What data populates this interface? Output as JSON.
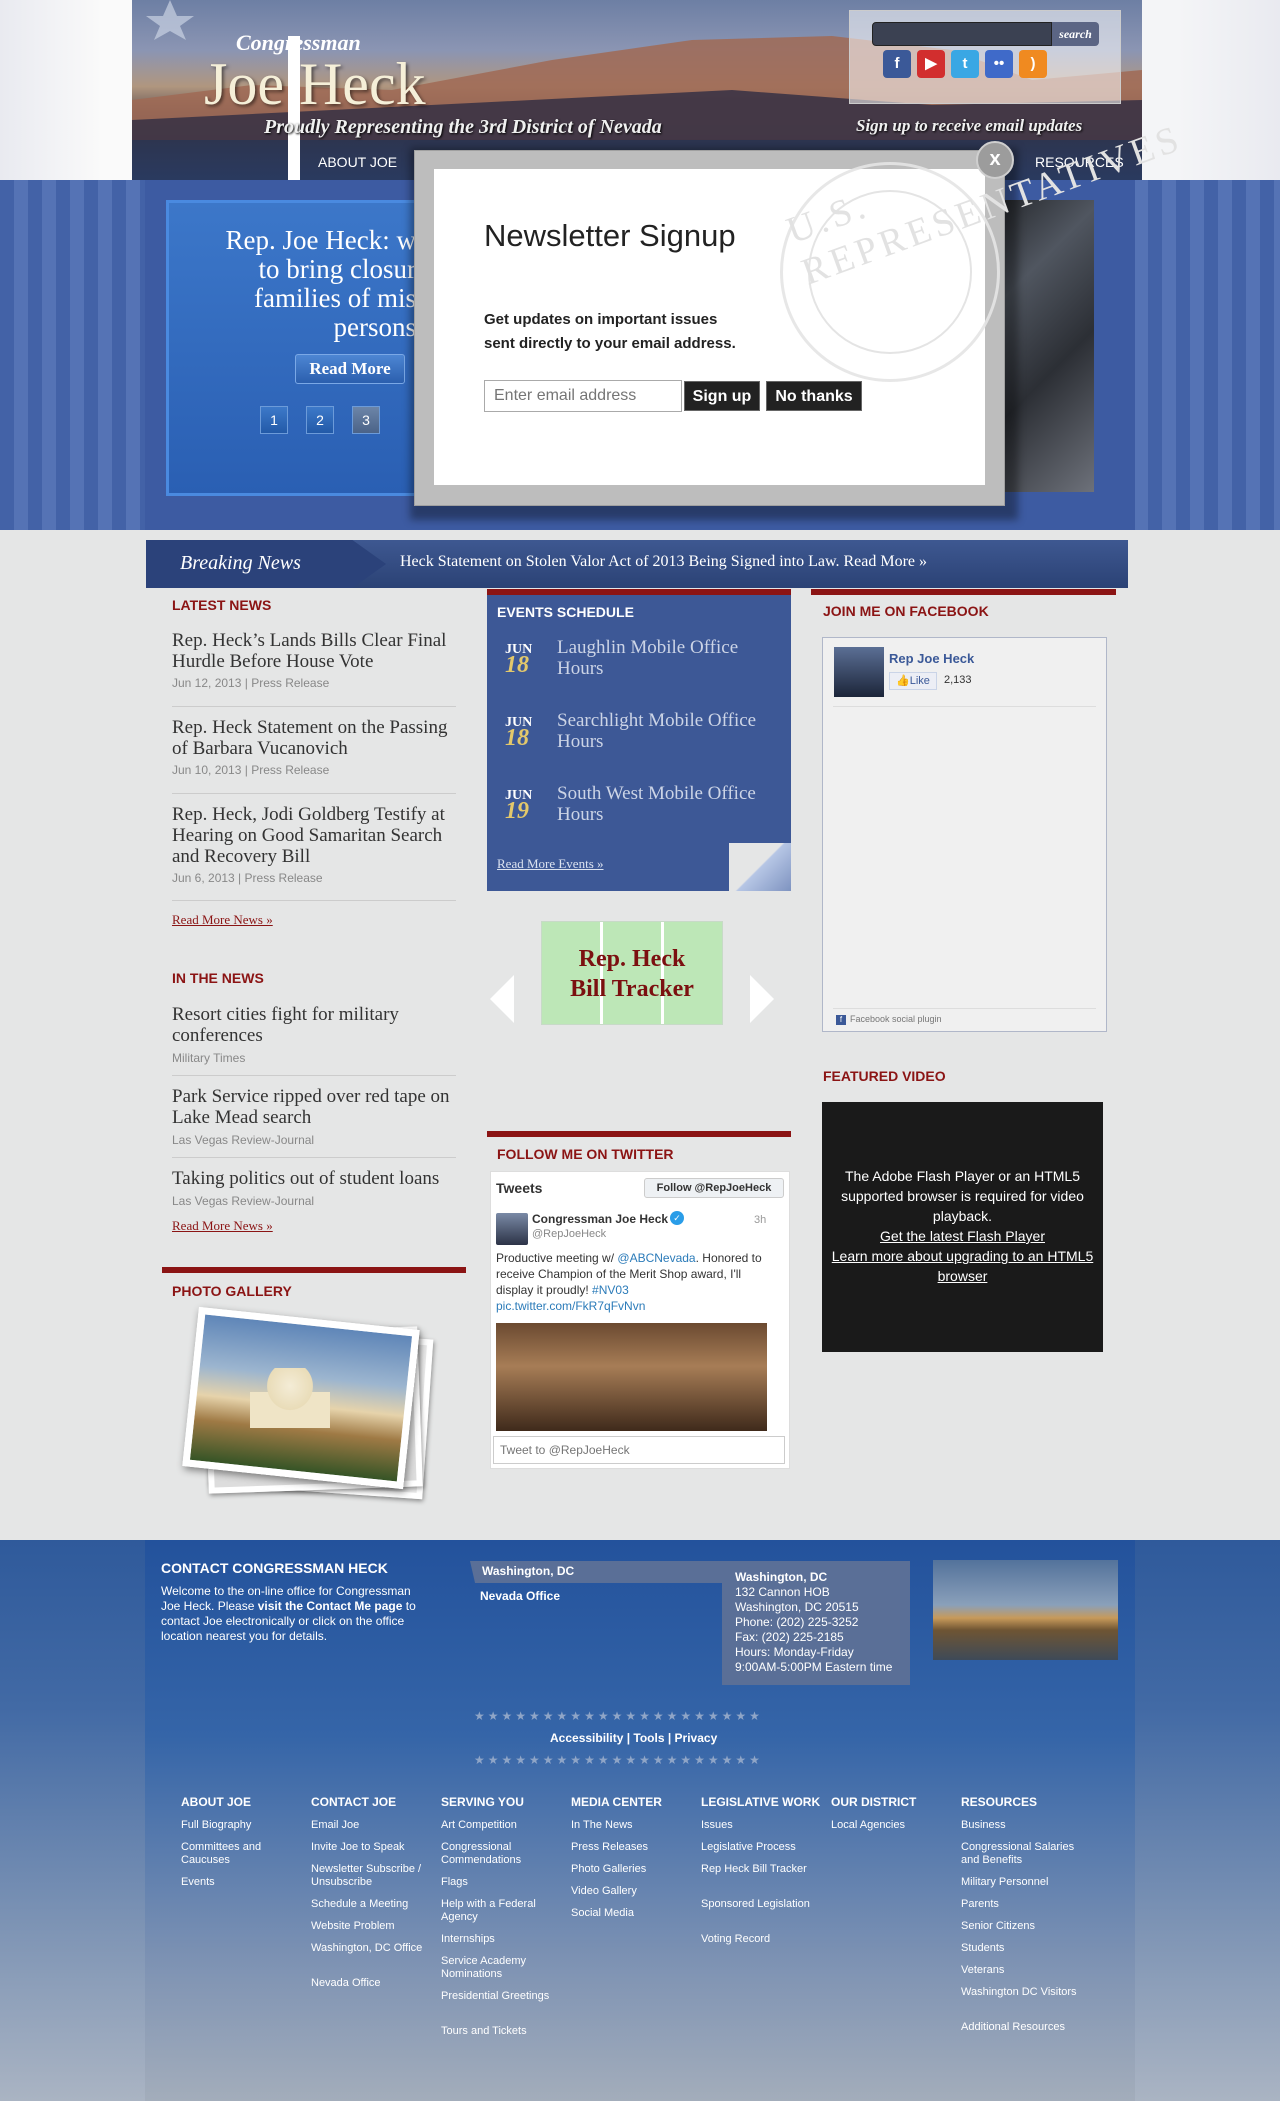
{
  "header": {
    "title_small": "Congressman",
    "title_big": "Joe Heck",
    "tagline": "Proudly Representing the 3rd District of Nevada",
    "signup_line": "Sign up to receive email updates",
    "search": {
      "placeholder": "",
      "button": "search"
    },
    "social": [
      {
        "name": "facebook-icon",
        "glyph": "f",
        "color": "#3b5998"
      },
      {
        "name": "youtube-icon",
        "glyph": "▶",
        "color": "#d22e2e"
      },
      {
        "name": "twitter-icon",
        "glyph": "t",
        "color": "#3aa7e4"
      },
      {
        "name": "flickr-icon",
        "glyph": "••",
        "color": "#3f6ac9"
      },
      {
        "name": "rss-icon",
        "glyph": ")",
        "color": "#f08a20"
      }
    ],
    "nav_left": "ABOUT JOE",
    "nav_right": "RESOURCES"
  },
  "slideshow": {
    "title": "Rep. Joe Heck: working to bring closure to families of missing persons",
    "title_lines": [
      "Rep. Joe Heck: w",
      "to bring closur",
      "families of mis",
      "persons"
    ],
    "read_more": "Read More",
    "pages": [
      "1",
      "2",
      "3"
    ],
    "active_page": 3
  },
  "modal": {
    "title": "Newsletter Signup",
    "description": "Get updates on important issues sent directly to your email address.",
    "email_placeholder": "Enter email address",
    "signup_button": "Sign up",
    "nothanks_button": "No thanks",
    "close": "x",
    "seal_text": "U.S. REPRESENTATIVES"
  },
  "breaking_news": {
    "label": "Breaking News",
    "text": "Heck Statement on Stolen Valor Act of 2013 Being Signed into Law. Read More »"
  },
  "latest_news": {
    "heading": "LATEST NEWS",
    "items": [
      {
        "title": "Rep. Heck’s Lands Bills Clear Final Hurdle Before House Vote",
        "date": "Jun 12, 2013",
        "type": "Press Release"
      },
      {
        "title": "Rep. Heck Statement on the Passing of Barbara Vucanovich",
        "date": "Jun 10, 2013",
        "type": "Press Release"
      },
      {
        "title": "Rep. Heck, Jodi Goldberg Testify at Hearing on Good Samaritan Search and Recovery Bill",
        "date": "Jun 6, 2013",
        "type": "Press Release"
      }
    ],
    "read_more": "Read More News »"
  },
  "in_the_news": {
    "heading": "IN THE NEWS",
    "items": [
      {
        "title": "Resort cities fight for military conferences",
        "source": "Military Times"
      },
      {
        "title": "Park Service ripped over red tape on Lake Mead search",
        "source": "Las Vegas Review-Journal"
      },
      {
        "title": "Taking politics out of student loans",
        "source": "Las Vegas Review-Journal"
      }
    ],
    "read_more": "Read More News »"
  },
  "photo_gallery": {
    "heading": "PHOTO GALLERY"
  },
  "events": {
    "heading": "EVENTS SCHEDULE",
    "items": [
      {
        "month": "JUN",
        "day": "18",
        "title": "Laughlin Mobile Office Hours"
      },
      {
        "month": "JUN",
        "day": "18",
        "title": "Searchlight Mobile Office Hours"
      },
      {
        "month": "JUN",
        "day": "19",
        "title": "South West Mobile Office Hours"
      }
    ],
    "read_more": "Read More Events »"
  },
  "bill_tracker": {
    "line1": "Rep. Heck",
    "line2": "Bill Tracker"
  },
  "twitter": {
    "heading": "FOLLOW ME ON TWITTER",
    "tweets_label": "Tweets",
    "follow_button": "Follow @RepJoeHeck",
    "tweet": {
      "name": "Congressman Joe Heck",
      "handle": "@RepJoeHeck",
      "time": "3h",
      "text_before": "Productive meeting w/ ",
      "mention": "@ABCNevada",
      "text_after": ". Honored to receive Champion of the Merit Shop award, I'll display it proudly! ",
      "hashtag": "#NV03",
      "link": "pic.twitter.com/FkR7qFvNvn"
    },
    "compose_placeholder": "Tweet to @RepJoeHeck"
  },
  "facebook": {
    "heading": "JOIN ME ON FACEBOOK",
    "page_name": "Rep Joe Heck",
    "like_label": "Like",
    "like_count": "2,133",
    "plugin_label": "Facebook social plugin"
  },
  "featured_video": {
    "heading": "FEATURED VIDEO",
    "message": "The Adobe Flash Player or an HTML5 supported browser is required for video playback.",
    "link1": "Get the latest Flash Player",
    "link2": "Learn more about upgrading to an HTML5 browser"
  },
  "footer": {
    "contact_heading": "CONTACT CONGRESSMAN HECK",
    "contact_text_1": "Welcome to the on-line office for Congressman Joe Heck. Please ",
    "contact_link": "visit the Contact Me page",
    "contact_text_2": " to contact Joe electronically or click on the office location nearest you for details.",
    "offices": [
      "Washington, DC",
      "Nevada Office"
    ],
    "office_details": {
      "name": "Washington, DC",
      "address1": "132 Cannon HOB",
      "address2": "Washington, DC 20515",
      "phone": "Phone: (202) 225-3252",
      "fax": "Fax: (202) 225-2185",
      "hours1": "Hours: Monday-Friday",
      "hours2": "9:00AM-5:00PM Eastern time"
    },
    "stars": "★★★★★★★★★★★★★★★★★★★★★",
    "util_links": [
      "Accessibility",
      "Tools",
      "Privacy"
    ],
    "columns": [
      {
        "heading": "ABOUT JOE",
        "items": [
          "Full Biography",
          "Committees and Caucuses",
          "Events"
        ]
      },
      {
        "heading": "CONTACT JOE",
        "items": [
          "Email Joe",
          "Invite Joe to Speak",
          "Newsletter Subscribe / Unsubscribe",
          "Schedule a Meeting",
          "Website Problem",
          "Washington, DC Office",
          "Nevada Office"
        ]
      },
      {
        "heading": "SERVING YOU",
        "items": [
          "Art Competition",
          "Congressional Commendations",
          "Flags",
          "Help with a Federal Agency",
          "Internships",
          "Service Academy Nominations",
          "Presidential Greetings",
          "Tours and Tickets"
        ]
      },
      {
        "heading": "MEDIA CENTER",
        "items": [
          "In The News",
          "Press Releases",
          "Photo Galleries",
          "Video Gallery",
          "Social Media"
        ]
      },
      {
        "heading": "LEGISLATIVE WORK",
        "items": [
          "Issues",
          "Legislative Process",
          "Rep Heck Bill Tracker",
          "Sponsored Legislation",
          "Voting Record"
        ]
      },
      {
        "heading": "OUR DISTRICT",
        "items": [
          "Local Agencies"
        ]
      },
      {
        "heading": "RESOURCES",
        "items": [
          "Business",
          "Congressional Salaries and Benefits",
          "Military Personnel",
          "Parents",
          "Senior Citizens",
          "Students",
          "Veterans",
          "Washington DC Visitors",
          "Additional Resources"
        ]
      }
    ]
  },
  "colors": {
    "accent_red": "#8b1414",
    "brand_blue": "#3d5896",
    "footer_blue": "#23529c"
  }
}
